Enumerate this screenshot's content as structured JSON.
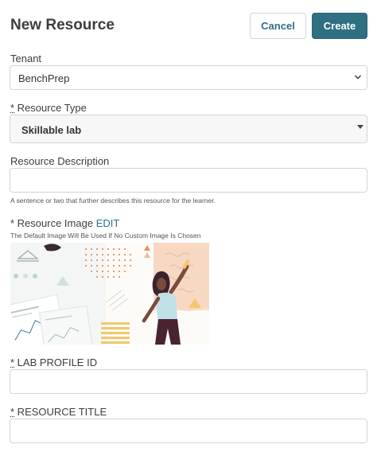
{
  "header": {
    "title": "New Resource",
    "cancel_label": "Cancel",
    "create_label": "Create"
  },
  "tenant": {
    "label": "Tenant",
    "value": "BenchPrep"
  },
  "resource_type": {
    "required_mark": "*",
    "label": " Resource Type",
    "value": "Skillable lab"
  },
  "description": {
    "label": "Resource Description",
    "value": "",
    "hint": "A sentence or two that further describes this resource for the learner."
  },
  "image": {
    "label": "* Resource Image",
    "edit_label": "EDIT",
    "hint": "The Default Image Will Be Used If No Custom Image Is Chosen"
  },
  "lab_profile": {
    "required_mark": "*",
    "label": " LAB PROFILE ID",
    "value": ""
  },
  "resource_title": {
    "required_mark": "*",
    "label": " RESOURCE TITLE",
    "value": ""
  },
  "colors": {
    "accent": "#2f6f82",
    "border": "#d4d4d4",
    "text": "#3d3d3d"
  },
  "icons": {
    "tenant_dropdown": "chevron-down-icon",
    "type_dropdown": "caret-down-icon"
  }
}
